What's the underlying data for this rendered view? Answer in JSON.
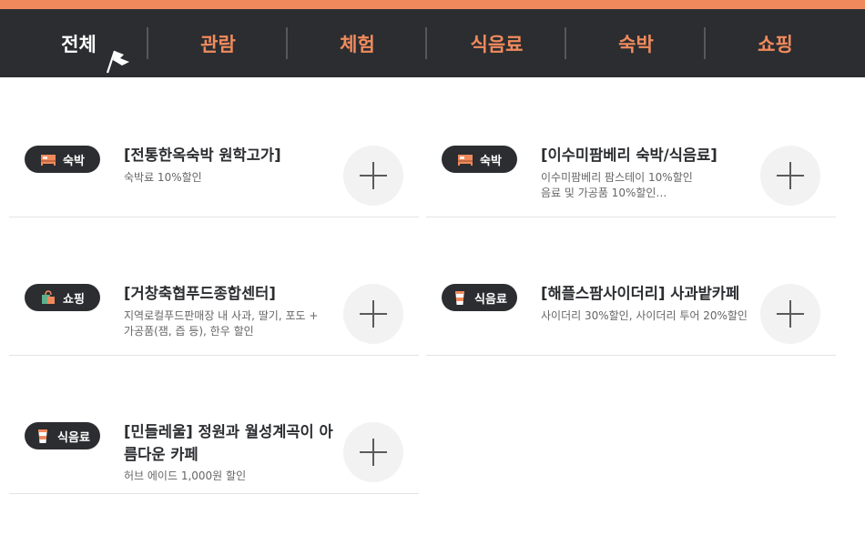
{
  "nav": {
    "items": [
      {
        "label": "전체",
        "active": true
      },
      {
        "label": "관람"
      },
      {
        "label": "체험"
      },
      {
        "label": "식음료"
      },
      {
        "label": "숙박"
      },
      {
        "label": "쇼핑"
      }
    ]
  },
  "colors": {
    "accent": "#f08a5d",
    "dark": "#2b2d30"
  },
  "cards": [
    {
      "category": "숙박",
      "icon": "bed-icon",
      "title": "[전통한옥숙박 원학고가]",
      "desc": [
        "숙박료 10%할인"
      ]
    },
    {
      "category": "숙박",
      "icon": "bed-icon",
      "title": "[이수미팜베리 숙박/식음료]",
      "desc": [
        "이수미팜베리 팜스테이 10%할인",
        "음료 및 가공품 10%할인…"
      ]
    },
    {
      "category": "쇼핑",
      "icon": "shopping-bag-icon",
      "title": "[거창축협푸드종합센터]",
      "desc": [
        "지역로컬푸드판매장 내 사과, 딸기, 포도 +",
        "가공품(잼, 즙 등), 한우 할인"
      ]
    },
    {
      "category": "식음료",
      "icon": "drink-cup-icon",
      "title": "[해플스팜사이더리] 사과밭카페",
      "desc": [
        "사이더리 30%할인, 사이더리 투어 20%할인"
      ]
    },
    {
      "category": "식음료",
      "icon": "drink-cup-icon",
      "title": "[민들레울] 정원과 월성계곡이 아름다운 카페",
      "desc": [
        "허브 에이드 1,000원 할인"
      ]
    }
  ]
}
